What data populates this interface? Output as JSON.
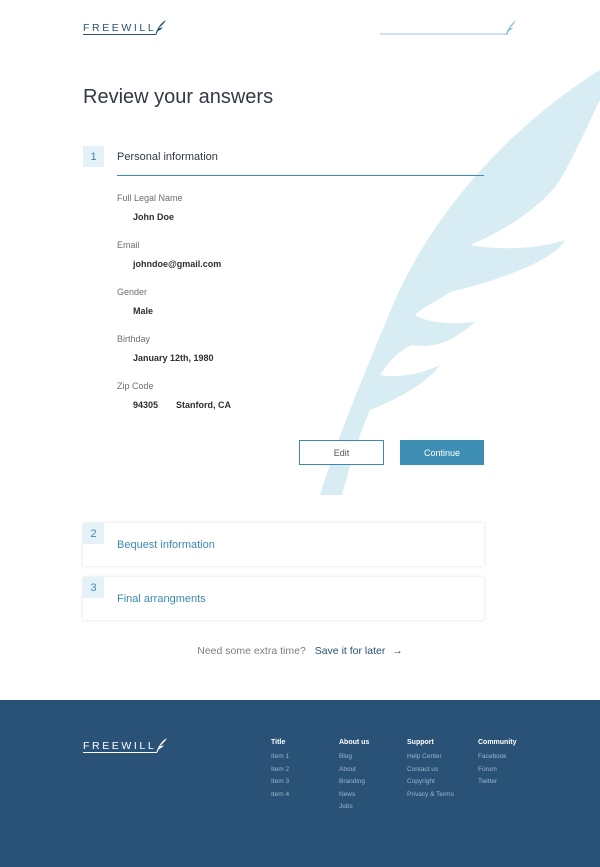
{
  "header": {
    "logo_text": "FREEWILL"
  },
  "progress": {
    "value": 1.0
  },
  "page_title": "Review your answers",
  "section1": {
    "number": "1",
    "title": "Personal information",
    "fields": [
      {
        "label": "Full Legal Name",
        "value": "John Doe"
      },
      {
        "label": "Email",
        "value": "johndoe@gmail.com"
      },
      {
        "label": "Gender",
        "value": "Male"
      },
      {
        "label": "Birthday",
        "value": "January 12th, 1980"
      },
      {
        "label": "Zip Code",
        "value": "94305",
        "city": "Stanford, CA"
      }
    ],
    "edit_label": "Edit",
    "continue_label": "Continue"
  },
  "section2": {
    "number": "2",
    "title": "Bequest information"
  },
  "section3": {
    "number": "3",
    "title": "Final arrangments"
  },
  "save_later": {
    "prompt": "Need some extra time?",
    "link": "Save it for later",
    "arrow": "→"
  },
  "footer": {
    "logo_text": "FREEWILL",
    "columns": [
      {
        "title": "Title",
        "items": [
          "Item 1",
          "Item 2",
          "Item 3",
          "Item 4"
        ]
      },
      {
        "title": "About us",
        "items": [
          "Blog",
          "About",
          "Branding",
          "News",
          "Jobs"
        ]
      },
      {
        "title": "Support",
        "items": [
          "Help Center",
          "Contact us",
          "Copyright",
          "Privacy & Terms"
        ]
      },
      {
        "title": "Community",
        "items": [
          "Facebook",
          "Forum",
          "Twitter"
        ]
      }
    ]
  },
  "colors": {
    "brand_navy": "#2a5277",
    "accent_blue": "#3f8fb5",
    "feather_bg": "#d7ecf3"
  },
  "icons": {
    "logo": "quill-feather-icon",
    "background": "feather-icon",
    "arrow": "arrow-right-icon"
  }
}
